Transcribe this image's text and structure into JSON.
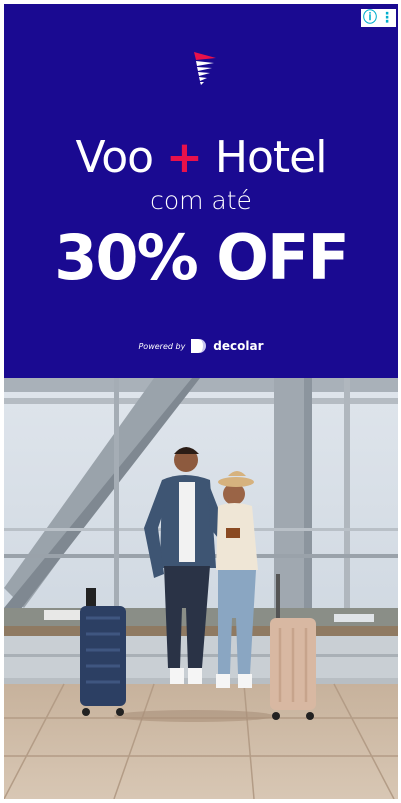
{
  "ad": {
    "headline_part1": "Voo",
    "headline_plus": "+",
    "headline_part2": "Hotel",
    "subline": "com até",
    "discount": "30% OFF",
    "powered_by": "Powered by",
    "partner": "decolar"
  },
  "colors": {
    "background": "#1a0a91",
    "accent": "#e8114b",
    "text": "#ffffff"
  },
  "adchoices": {
    "info_glyph": "ⓘ",
    "menu_glyph": "⋮"
  }
}
